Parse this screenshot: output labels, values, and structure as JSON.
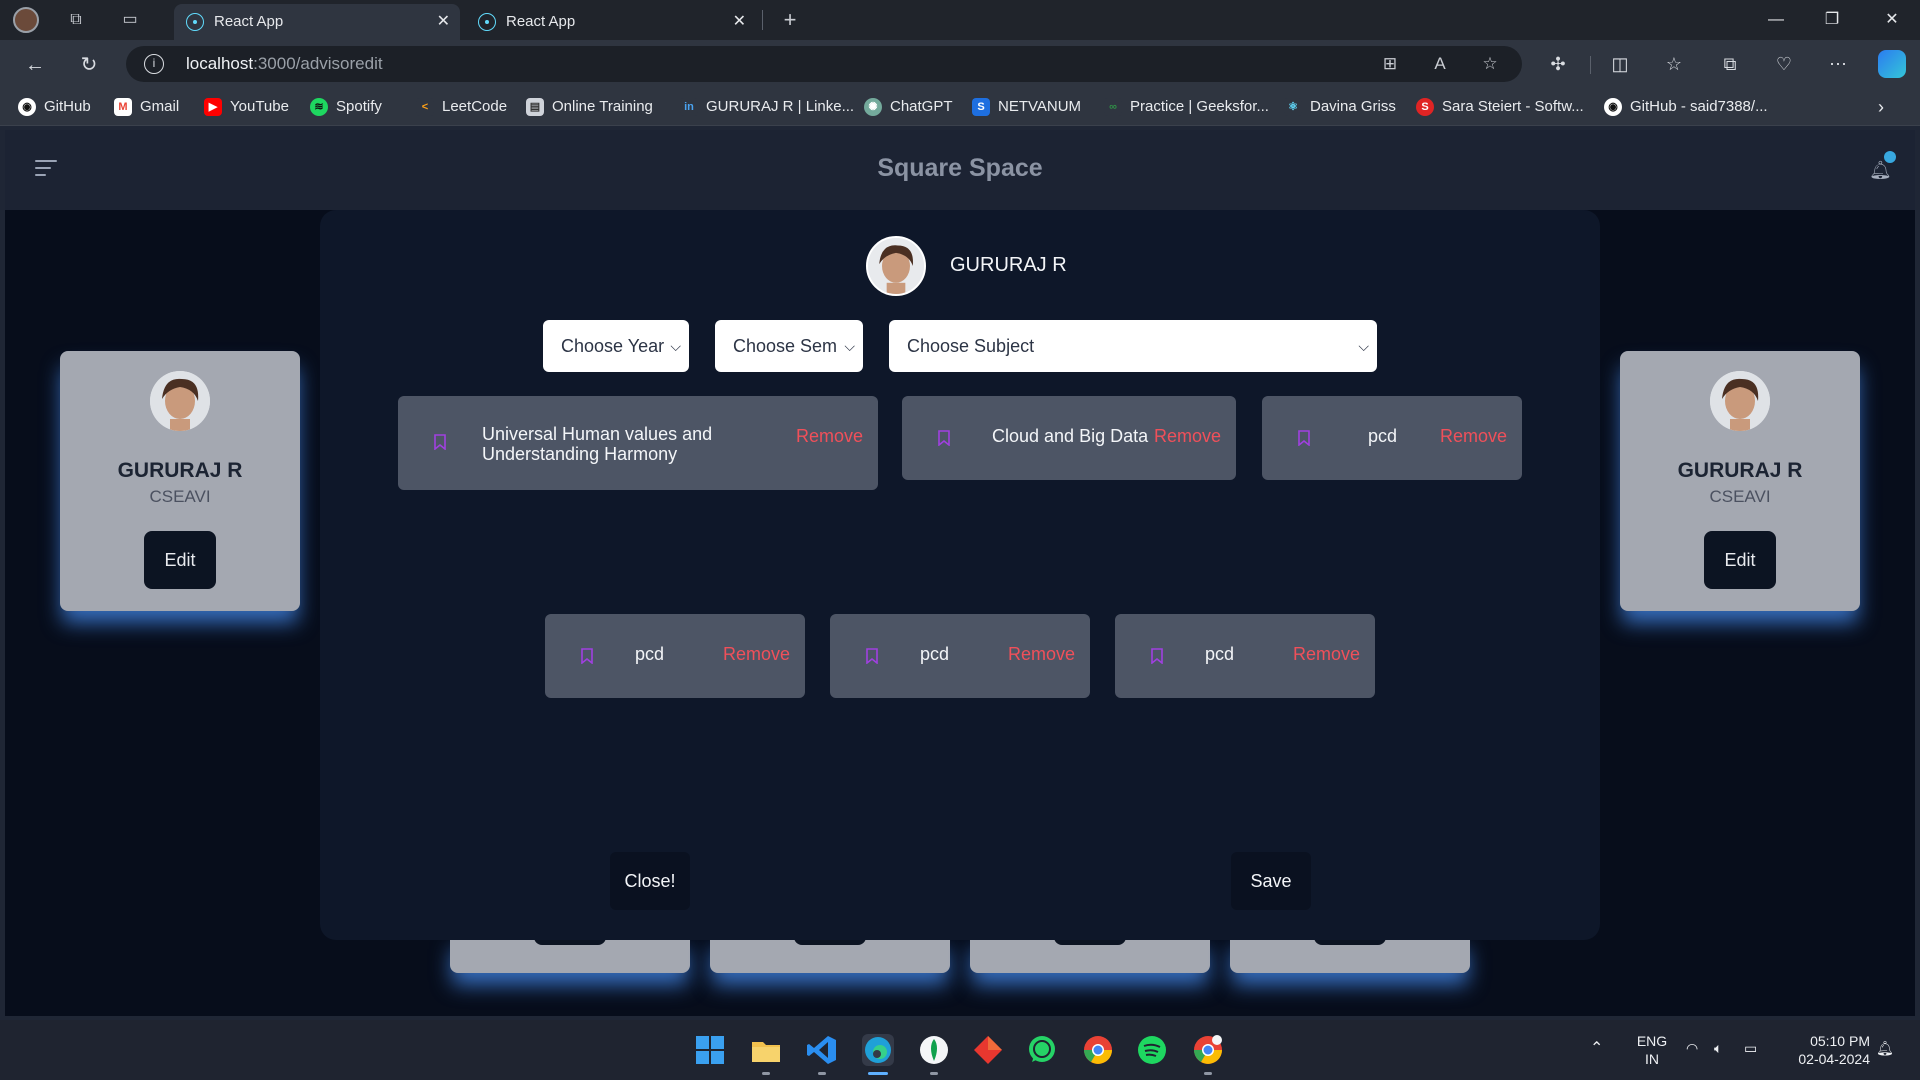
{
  "browser": {
    "tabs": [
      {
        "title": "React App",
        "close": "✕"
      },
      {
        "title": "React App",
        "close": "✕"
      }
    ],
    "new_tab": "+",
    "url_host": "localhost",
    "url_path": ":3000/advisoredit",
    "bookmarks": [
      {
        "label": "GitHub",
        "icon": "github-icon",
        "color": "#ffffff"
      },
      {
        "label": "Gmail",
        "icon": "gmail-icon",
        "color": "#ea4335"
      },
      {
        "label": "YouTube",
        "icon": "youtube-icon",
        "color": "#ff0000"
      },
      {
        "label": "Spotify",
        "icon": "spotify-icon",
        "color": "#1ed760"
      },
      {
        "label": "LeetCode",
        "icon": "leetcode-icon",
        "color": "#ffa116"
      },
      {
        "label": "Online Training",
        "icon": "page-icon",
        "color": "#cfd3da"
      },
      {
        "label": "GURURAJ R | Linke...",
        "icon": "linkedin-icon",
        "color": "#0a66c2"
      },
      {
        "label": "ChatGPT",
        "icon": "chatgpt-icon",
        "color": "#74aa9c"
      },
      {
        "label": "NETVANUM",
        "icon": "netvanum-icon",
        "color": "#1e6fe0"
      },
      {
        "label": "Practice | Geeksfor...",
        "icon": "geeksforgeeks-icon",
        "color": "#2f8d46"
      },
      {
        "label": "Davina Griss",
        "icon": "react-icon",
        "color": "#61dafb"
      },
      {
        "label": "Sara Steiert - Softw...",
        "icon": "s-icon",
        "color": "#e02424"
      },
      {
        "label": "GitHub - said7388/...",
        "icon": "github-icon",
        "color": "#ffffff"
      }
    ]
  },
  "app": {
    "brand": "Square Space",
    "side_cards": [
      {
        "name": "GURURAJ R",
        "dept": "CSEAVI",
        "edit": "Edit"
      },
      {
        "name": "GURURAJ R",
        "dept": "CSEAVI",
        "edit": "Edit"
      }
    ]
  },
  "modal": {
    "user_name": "GURURAJ R",
    "year_select": "Choose Year",
    "sem_select": "Choose Sem",
    "subject_select": "Choose Subject",
    "remove_label": "Remove",
    "subjects": [
      {
        "line1": "Universal Human values and",
        "line2": "Understanding Harmony"
      },
      {
        "line1": "Cloud and Big Data"
      },
      {
        "line1": "pcd"
      },
      {
        "line1": "pcd"
      },
      {
        "line1": "pcd"
      },
      {
        "line1": "pcd"
      }
    ],
    "close_button": "Close!",
    "save_button": "Save"
  },
  "taskbar": {
    "language": "ENG",
    "region": "IN",
    "time": "05:10 PM",
    "date": "02-04-2024"
  },
  "colors": {
    "remove": "#f0505a",
    "bookmark_icon": "#a040e0",
    "card_glow": "#468cf0",
    "modal_bg": "#0e1729"
  }
}
